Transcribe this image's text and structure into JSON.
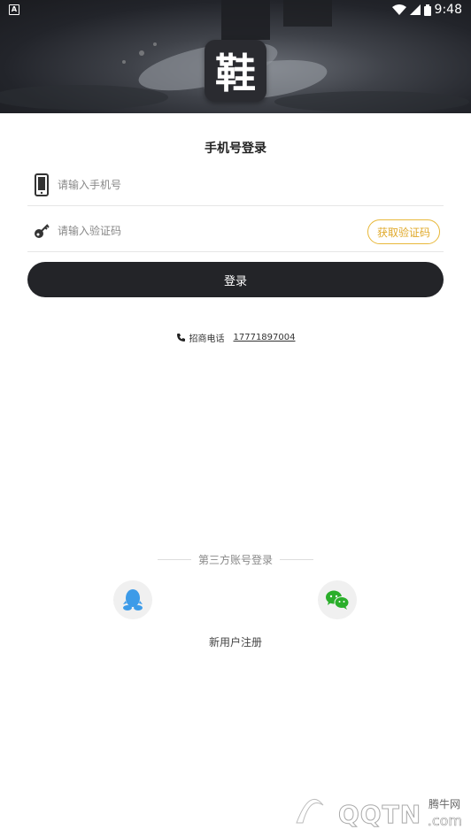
{
  "status_bar": {
    "time": "9:48",
    "badge": "A"
  },
  "header": {
    "logo_text": "鞋"
  },
  "page_title": "手机号登录",
  "phone_field": {
    "placeholder": "请输入手机号"
  },
  "code_field": {
    "placeholder": "请输入验证码",
    "get_code_label": "获取验证码"
  },
  "login_button": "登录",
  "hotline": {
    "label": "招商电话",
    "number": "17771897004"
  },
  "third_party": {
    "title": "第三方账号登录",
    "qq_icon": "qq-icon",
    "wechat_icon": "wechat-icon"
  },
  "register_label": "新用户注册",
  "watermark": {
    "top": "腾牛网",
    "main": "QQTN",
    "suffix": ".com"
  },
  "colors": {
    "accent": "#e8b83a",
    "button_dark": "#232428",
    "qq": "#3d9be8",
    "wechat": "#2aae2a"
  }
}
